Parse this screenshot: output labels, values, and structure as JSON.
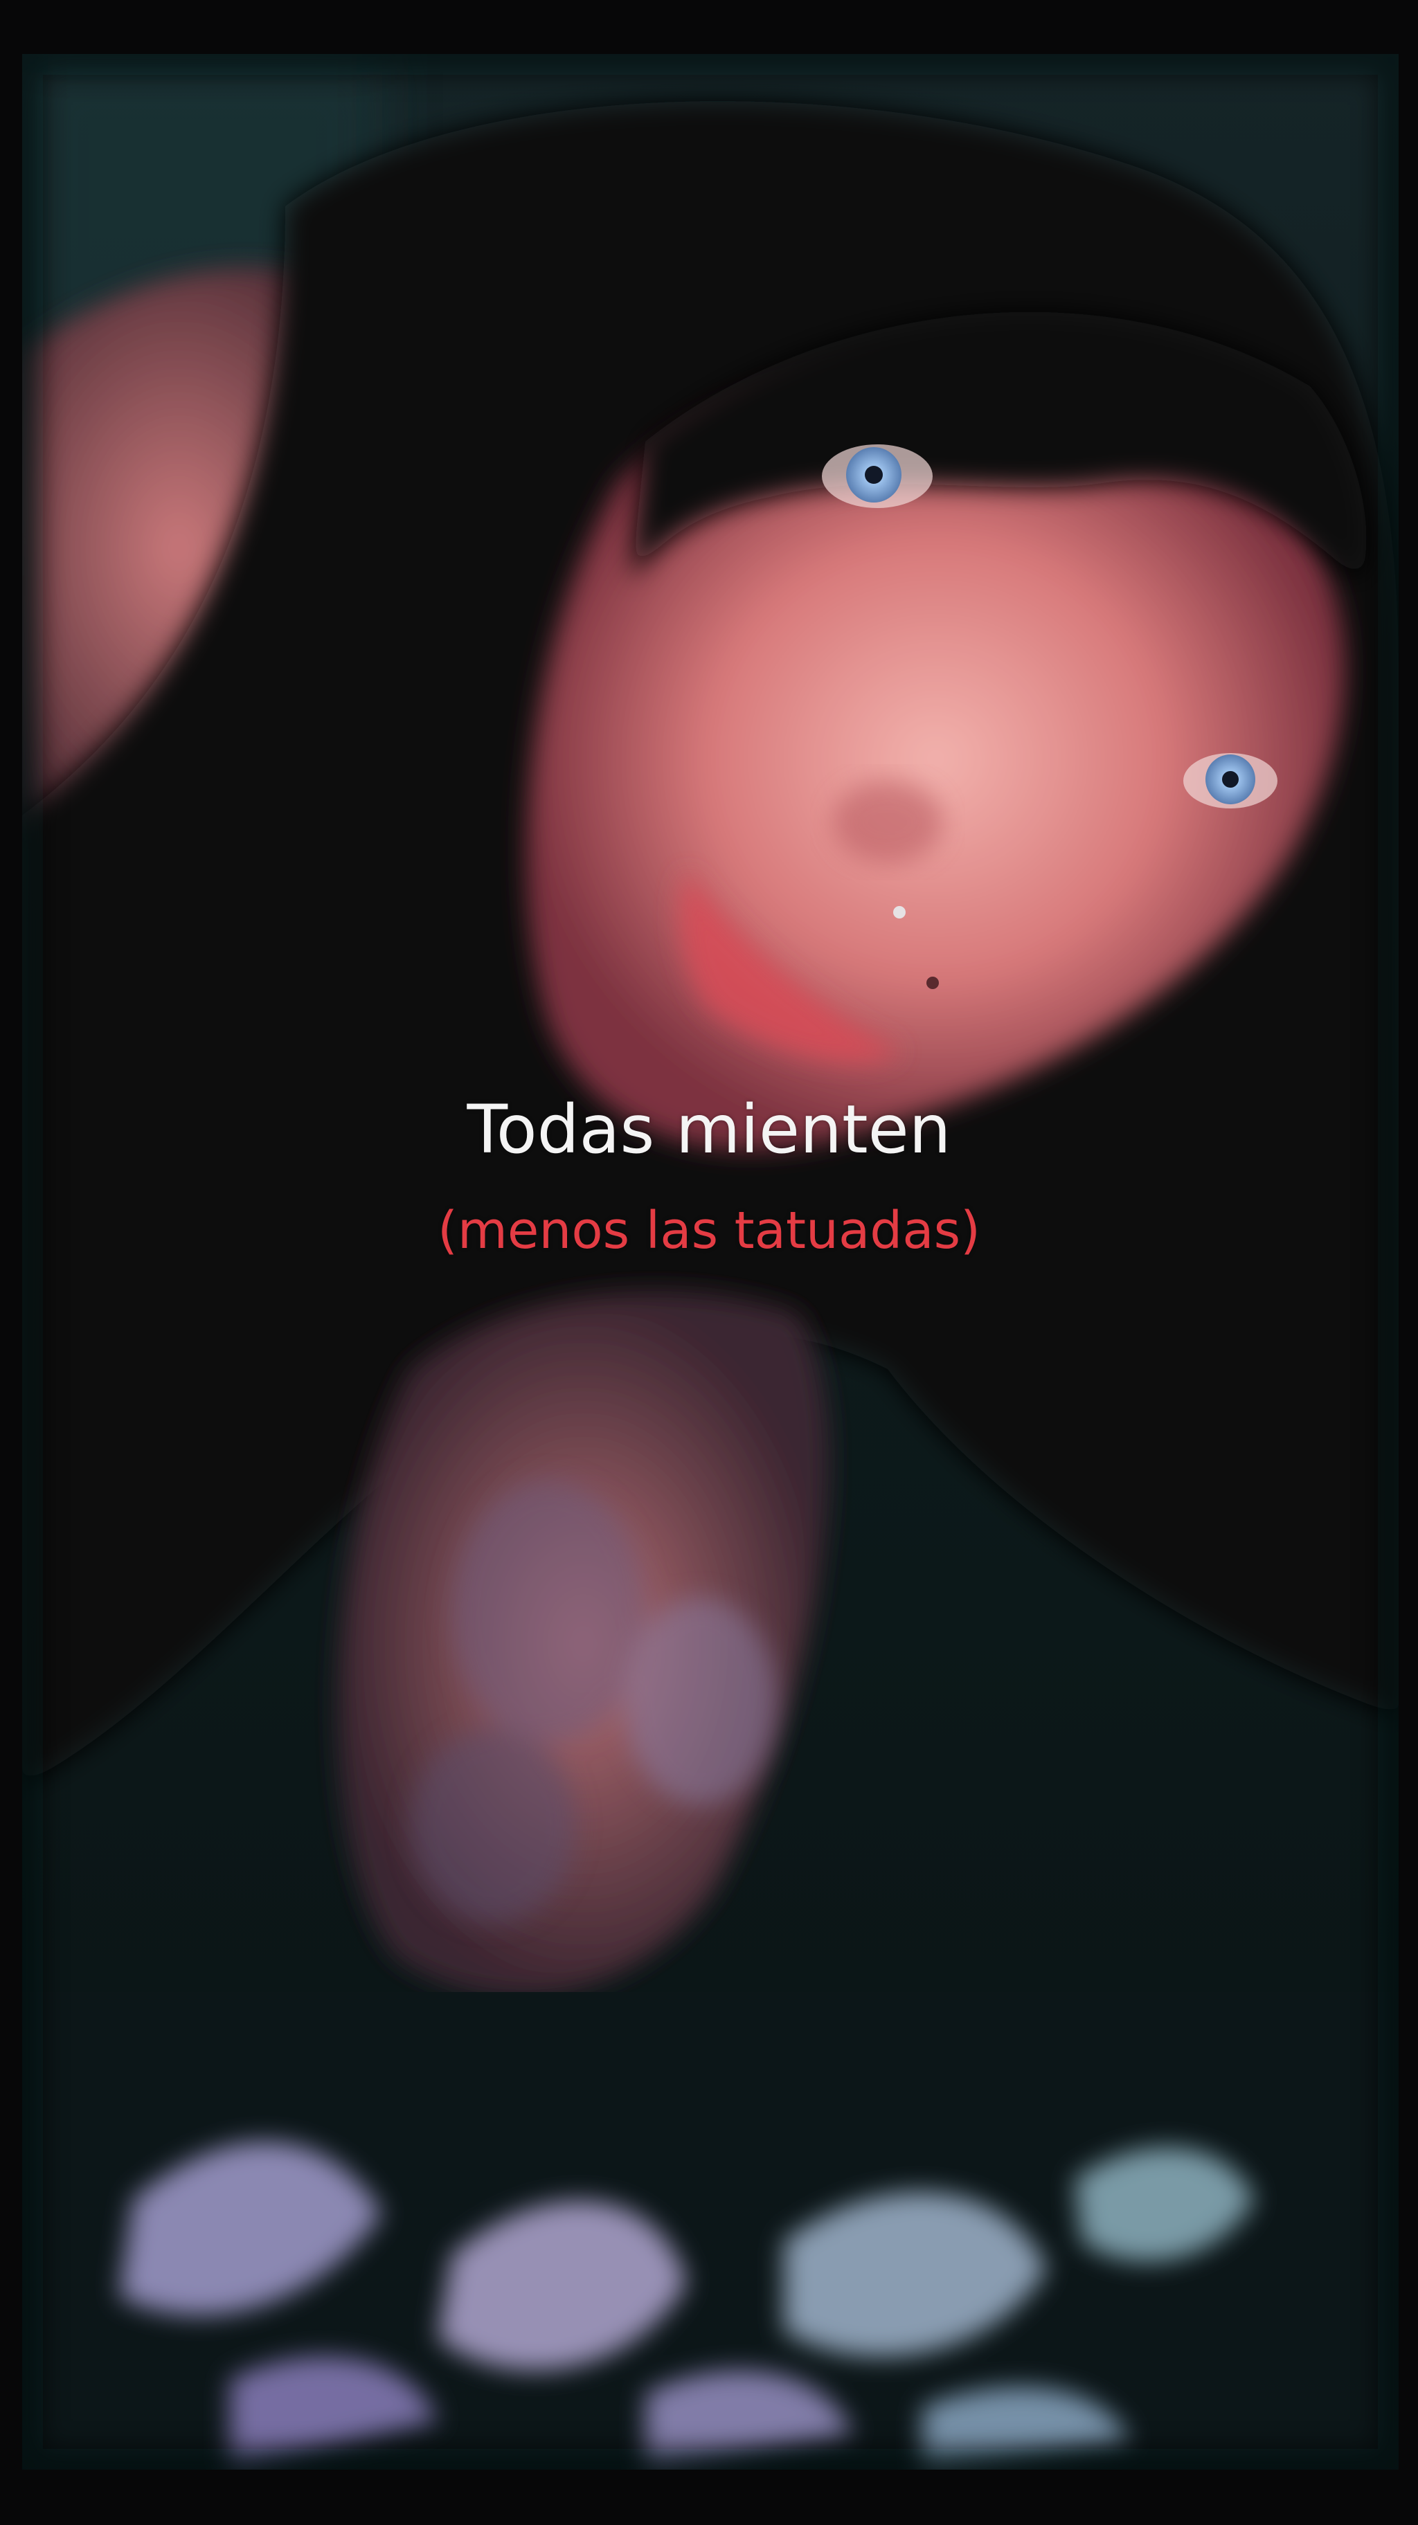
{
  "overlay": {
    "headline": "Todas mienten",
    "subline": "(menos las tatuadas)"
  },
  "colors": {
    "background": "#070708",
    "headline": "#f4f4f4",
    "subline": "#e43c44",
    "eyes": "#8fb6e6"
  }
}
